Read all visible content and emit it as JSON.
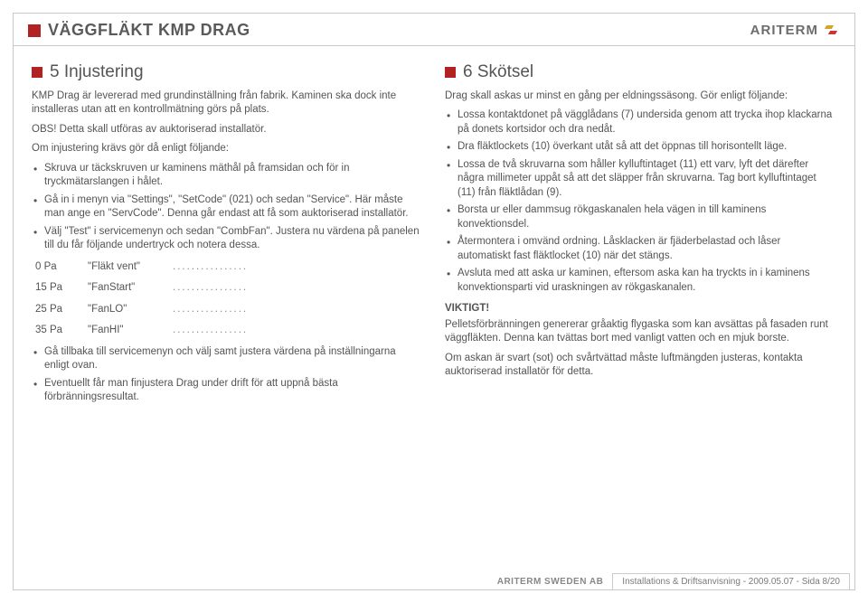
{
  "header": {
    "title": "VÄGGFLÄKT KMP DRAG",
    "brand": "ARITERM"
  },
  "left": {
    "sec_title": "5 Injustering",
    "p1": "KMP Drag är levererad med grundinställning från fabrik. Kaminen ska dock inte installeras utan att en kontrollmätning görs på plats.",
    "p2": "OBS! Detta skall utföras av auktoriserad installatör.",
    "p3": "Om injustering krävs gör då enligt följande:",
    "b1": "Skruva ur täckskruven ur kaminens mäthål på framsidan och för in tryckmätarslangen i hålet.",
    "b2": "Gå in i menyn via \"Settings\", \"SetCode\" (021) och sedan \"Service\". Här måste man ange en \"ServCode\". Denna går endast att få som auktoriserad installatör.",
    "b3": "Välj \"Test\" i servicemenyn och sedan \"CombFan\". Justera nu värdena på panelen till du får följande undertryck och notera dessa.",
    "rows": [
      {
        "pa": "0 Pa",
        "label": "\"Fläkt vent\""
      },
      {
        "pa": "15 Pa",
        "label": "\"FanStart\""
      },
      {
        "pa": "25 Pa",
        "label": "\"FanLO\""
      },
      {
        "pa": "35 Pa",
        "label": "\"FanHI\""
      }
    ],
    "b4": "Gå tillbaka till servicemenyn och välj samt justera värdena på inställningarna enligt ovan.",
    "b5": "Eventuellt får man finjustera Drag under drift för att uppnå bästa förbränningsresultat."
  },
  "right": {
    "sec_title": "6 Skötsel",
    "p1": "Drag skall askas ur minst en gång per eldningssäsong. Gör enligt följande:",
    "b1": "Lossa kontaktdonet på vägglådans (7) undersida genom att trycka ihop klackarna på donets kortsidor och dra nedåt.",
    "b2": "Dra fläktlockets (10) överkant utåt så att det öppnas till horisontellt läge.",
    "b3": "Lossa de två skruvarna som håller kylluftintaget (11) ett varv, lyft det därefter några millimeter uppåt så att det släpper från skruvarna. Tag bort kylluftintaget (11) från fläktlådan (9).",
    "b4": "Borsta ur eller dammsug rökgaskanalen hela vägen in till kaminens konvektionsdel.",
    "b5": "Återmontera i omvänd ordning. Låsklacken är fjäderbelastad och låser automatiskt fast fläktlocket (10) när det stängs.",
    "b6": "Avsluta med att aska ur kaminen, eftersom aska kan ha tryckts in i kaminens konvektionsparti vid uraskningen av rökgaskanalen.",
    "note_head": "VIKTIGT!",
    "note1": "Pelletsförbränningen genererar gråaktig flygaska som kan avsättas på fasaden runt väggfläkten. Denna kan tvättas bort med vanligt vatten och en mjuk borste.",
    "note2": "Om askan är svart (sot) och svårtvättad måste luftmängden justeras, kontakta auktoriserad installatör för detta."
  },
  "footer": {
    "brand": "ARITERM SWEDEN AB",
    "info": "Installations & Driftsanvisning - 2009.05.07 - Sida 8/20"
  }
}
